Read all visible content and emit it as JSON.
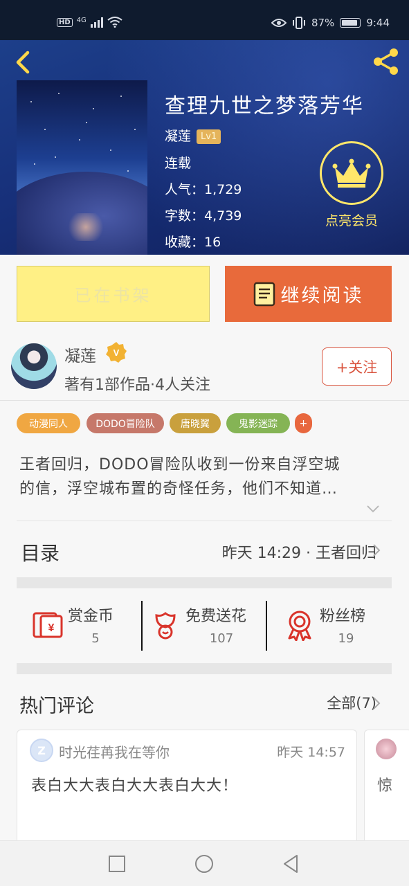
{
  "status_bar": {
    "network_badge": "HD",
    "network_type": "4G",
    "battery_percent": "87%",
    "time": "9:44"
  },
  "header": {
    "back_icon": "chevron-left-icon",
    "share_icon": "share-icon"
  },
  "book": {
    "title": "查理九世之梦落芳华",
    "author": "凝莲",
    "level_badge": "Lv1",
    "status": "连载",
    "popularity": "人气：1,729",
    "word_count": "字数：4,739",
    "favorites": "收藏：16",
    "vip_label": "点亮会员"
  },
  "actions": {
    "shelf_label": "已在书架",
    "read_label": "继续阅读"
  },
  "author": {
    "name": "凝莲",
    "stats": "著有1部作品·4人关注",
    "follow_label": "+关注"
  },
  "tags": [
    {
      "label": "动漫同人",
      "color": "#f0a742"
    },
    {
      "label": "DODO冒险队",
      "color": "#c6786a"
    },
    {
      "label": "唐晓翼",
      "color": "#c9a03d"
    },
    {
      "label": "鬼影迷踪",
      "color": "#85b455"
    },
    {
      "label": "+",
      "color": "#e8673e"
    }
  ],
  "description": {
    "line1": "王者回归，DODO冒险队收到一份来自浮空城",
    "line2": "的信，浮空城布置的奇怪任务，他们不知道…"
  },
  "toc": {
    "label": "目录",
    "latest": "昨天 14:29 · 王者回归"
  },
  "rewards": [
    {
      "name": "赏金币",
      "count": "5",
      "icon": "red-envelope-icon"
    },
    {
      "name": "免费送花",
      "count": "107",
      "icon": "flower-icon"
    },
    {
      "name": "粉丝榜",
      "count": "19",
      "icon": "medal-icon"
    }
  ],
  "hot_comments": {
    "title": "热门评论",
    "all_label": "全部(7)",
    "comments": [
      {
        "user": "时光荏苒我在等你",
        "time": "昨天 14:57",
        "text": "表白大大表白大大表白大大！"
      },
      {
        "text": "惊"
      }
    ]
  },
  "colors": {
    "accent_orange": "#e86a3b",
    "shelf_yellow": "#fff085",
    "vip_gold": "#ffe76a",
    "header_blue": "#17307a"
  }
}
